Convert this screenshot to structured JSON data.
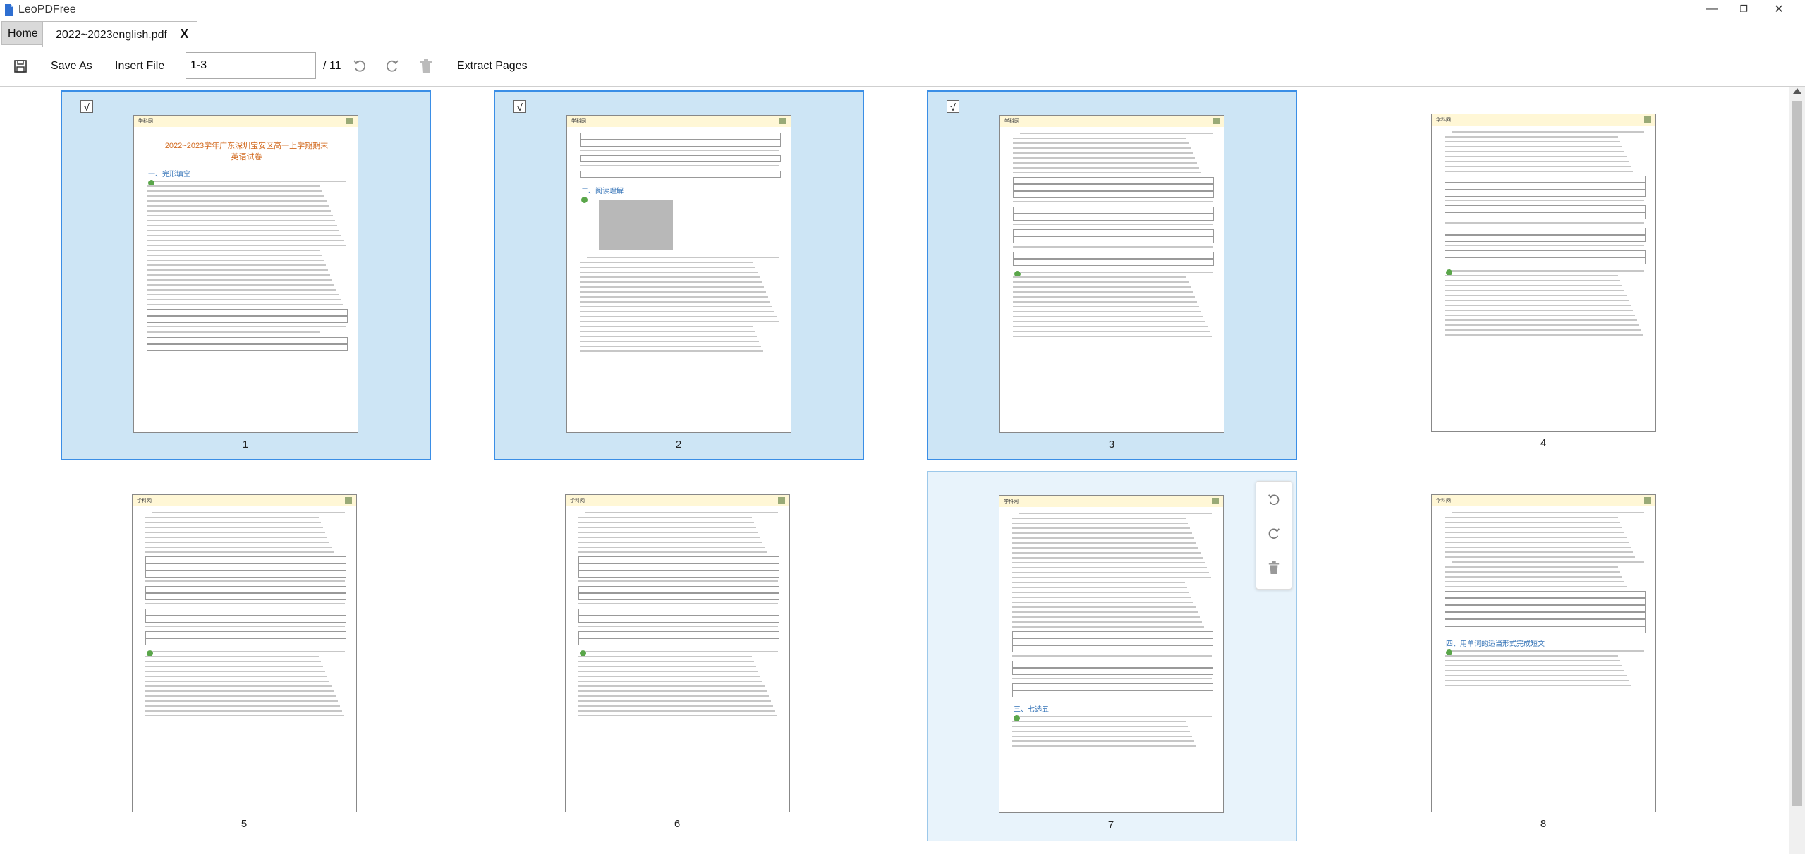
{
  "app": {
    "title": "LeoPDFree"
  },
  "window_controls": {
    "minimize": "—",
    "restore": "❐",
    "close": "✕"
  },
  "tabs": {
    "home_label": "Home",
    "document_label": "2022~2023english.pdf",
    "close_label": "X"
  },
  "toolbar": {
    "save_as_label": "Save As",
    "insert_file_label": "Insert File",
    "page_range_value": "1-3",
    "total_pages": "/ 11",
    "extract_pages_label": "Extract Pages"
  },
  "checkbox_mark": "√",
  "pages": [
    {
      "number": "1",
      "selected": true,
      "header_logo": "学科网",
      "title_line1": "2022~2023学年广东深圳宝安区高一上学期期末",
      "title_line2": "英语试卷",
      "section": "一、完形填空"
    },
    {
      "number": "2",
      "selected": true,
      "header_logo": "学科网",
      "section": "二、阅读理解"
    },
    {
      "number": "3",
      "selected": true,
      "header_logo": "学科网"
    },
    {
      "number": "4",
      "selected": false,
      "header_logo": "学科网"
    },
    {
      "number": "5",
      "selected": false,
      "header_logo": "学科网"
    },
    {
      "number": "6",
      "selected": false,
      "header_logo": "学科网"
    },
    {
      "number": "7",
      "selected": false,
      "hovered": true,
      "header_logo": "学科网",
      "section": "三、七选五"
    },
    {
      "number": "8",
      "selected": false,
      "header_logo": "学科网",
      "section": "四、用单词的适当形式完成短文"
    }
  ],
  "hover_tools": [
    "rotate-left-icon",
    "rotate-right-icon",
    "delete-icon"
  ]
}
